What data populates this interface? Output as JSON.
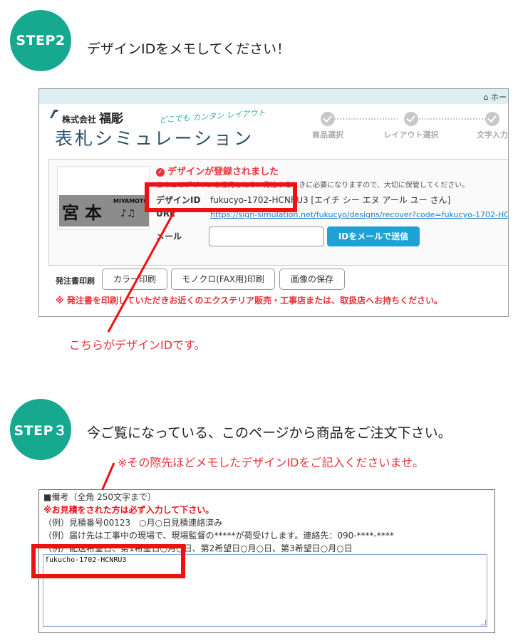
{
  "step2": {
    "badge": "STEP2",
    "heading": "デザインIDをメモしてください！",
    "panel": {
      "home_link": "ホー",
      "company_label": "株式会社",
      "company_name": "福彫",
      "tagline": "どこでも カンタン レイアウト",
      "app_title": "表札シミュレーション",
      "nav_steps": [
        "商品選択",
        "レイアウト選択",
        "文字入力"
      ],
      "nameplate": {
        "kanji": "宮本",
        "roman": "MIYAMOTO",
        "notes": "♪♫"
      },
      "registered_msg": "デザインが登録されました",
      "note": "このIDはデザインを復元したり、発注するときに必要になりますので、大切に保管してください。",
      "design_id_label": "デザインID",
      "design_id_value": "fukucyo-1702-HCNRU3 [エイチ シー エヌ アール ユー さん]",
      "url_label": "URL",
      "url_value": "https://sign-simulation.net/fukucyo/designs/recover?code=fukucyo-1702-HC",
      "email_label": "メール",
      "email_value": "",
      "send_button": "IDをメールで送信",
      "print_label": "発注書印刷",
      "print_buttons": [
        "カラー印刷",
        "モノクロ(FAX用)印刷",
        "画像の保存"
      ],
      "print_note": "※ 発注書を印刷していただきお近くのエクステリア販売・工事店または、取扱店へお持ちください。"
    },
    "caption": "こちらがデザインIDです。"
  },
  "step3": {
    "badge": "STEP３",
    "heading": "今ご覧になっている、このページから商品をご注文下さい。",
    "subnote": "※その際先ほどメモしたデザインIDをご記入くださいませ。",
    "remarks": {
      "title": "■備考（全角 250文字まで）",
      "required": "※お見積をされた方は必ず入力して下さい。",
      "examples": [
        "（例）見積番号00123　○月○日見積連絡済み",
        "（例）届け先は工事中の現場で、現場監督の*****が荷受けします。連絡先：090-****-****",
        "（例）配送希望日、第1希望日○月○日、第2希望日○月○日、第3希望日○月○日"
      ],
      "value": "fukucho-1702-HCNRU3"
    }
  },
  "colors": {
    "accent": "#17a98f",
    "highlight": "#f01010",
    "link": "#1a7ecb",
    "button": "#1ea2d5"
  }
}
